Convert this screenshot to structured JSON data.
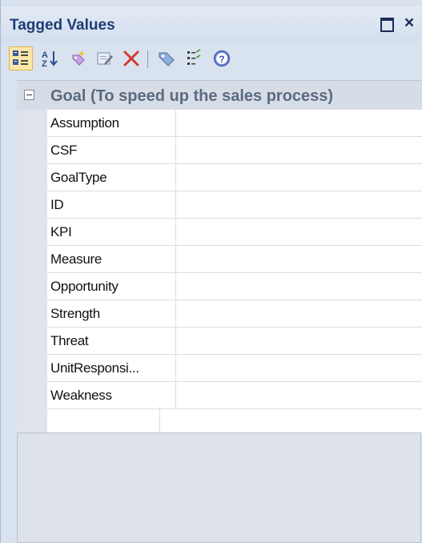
{
  "window": {
    "title": "Tagged Values",
    "maximize_icon": "maximize-icon",
    "close_icon": "close-icon",
    "close_glyph": "×"
  },
  "toolbar": {
    "buttons": [
      {
        "icon": "categorized-view-icon",
        "active": true
      },
      {
        "icon": "sort-alphabetical-icon",
        "active": false
      },
      {
        "icon": "new-tag-icon",
        "active": false
      },
      {
        "icon": "edit-notes-icon",
        "active": false
      },
      {
        "icon": "delete-icon",
        "active": false
      },
      {
        "icon": "tag-icon",
        "active": false
      },
      {
        "icon": "show-all-icon",
        "active": false
      },
      {
        "icon": "help-icon",
        "active": false
      }
    ]
  },
  "grid": {
    "category": {
      "label": "Goal (To speed up the sales process)",
      "expanded": true
    },
    "properties": [
      {
        "name": "Assumption",
        "value": ""
      },
      {
        "name": "CSF",
        "value": ""
      },
      {
        "name": "GoalType",
        "value": ""
      },
      {
        "name": "ID",
        "value": ""
      },
      {
        "name": "KPI",
        "value": ""
      },
      {
        "name": "Measure",
        "value": ""
      },
      {
        "name": "Opportunity",
        "value": ""
      },
      {
        "name": "Strength",
        "value": ""
      },
      {
        "name": "Threat",
        "value": ""
      },
      {
        "name": "UnitResponsi...",
        "value": ""
      },
      {
        "name": "Weakness",
        "value": ""
      }
    ]
  },
  "colors": {
    "title_text": "#1f3d75",
    "panel_bg": "#d9e2ef",
    "delete_red": "#d23a2f"
  }
}
